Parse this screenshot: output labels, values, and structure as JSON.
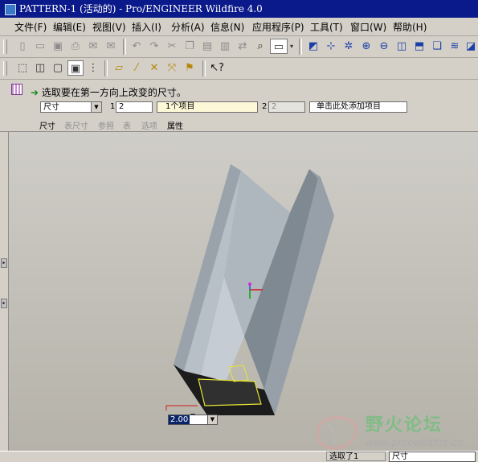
{
  "window": {
    "title": "PATTERN-1 (活动的) - Pro/ENGINEER Wildfire 4.0"
  },
  "menu": [
    "文件(F)",
    "编辑(E)",
    "视图(V)",
    "插入(I)",
    "分析(A)",
    "信息(N)",
    "应用程序(P)",
    "工具(T)",
    "窗口(W)",
    "帮助(H)"
  ],
  "dashboard": {
    "prompt": "选取要在第一方向上改变的尺寸。",
    "type_select": "尺寸",
    "dir1_label": "1",
    "dir1_count": "2",
    "dir1_items": "1个项目",
    "dir2_label": "2",
    "dir2_count": "2",
    "dir2_items": "单击此处添加项目",
    "tabs": [
      "尺寸",
      "表尺寸",
      "参照",
      "表",
      "选项",
      "属性"
    ]
  },
  "viewport": {
    "dimension_value": "2.00"
  },
  "status": {
    "selected": "选取了1",
    "filter": "尺寸"
  },
  "watermark": {
    "cn": "野火论坛",
    "url": "www.proewildfire.cn"
  }
}
